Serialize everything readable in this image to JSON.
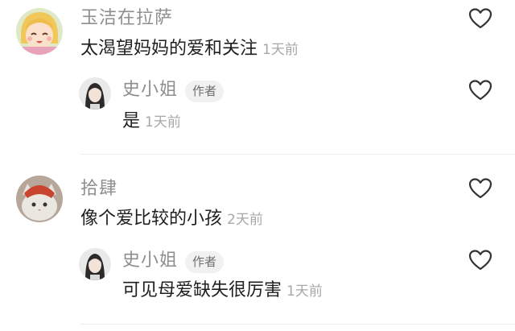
{
  "comments": [
    {
      "author": "玉洁在拉萨",
      "text": "太渴望妈妈的爱和关注",
      "time": "1天前",
      "reply": {
        "author": "史小姐",
        "badge": "作者",
        "text": "是",
        "time": "1天前"
      }
    },
    {
      "author": "拾肆",
      "text": "像个爱比较的小孩",
      "time": "2天前",
      "reply": {
        "author": "史小姐",
        "badge": "作者",
        "text": "可见母爱缺失很厉害",
        "time": "1天前"
      }
    }
  ],
  "icons": {
    "like": "heart-outline-icon"
  },
  "colors": {
    "name": "#8e8e8e",
    "text": "#1f1f1f",
    "time": "#a8a8a8",
    "badge_bg": "#f1f1f1"
  }
}
